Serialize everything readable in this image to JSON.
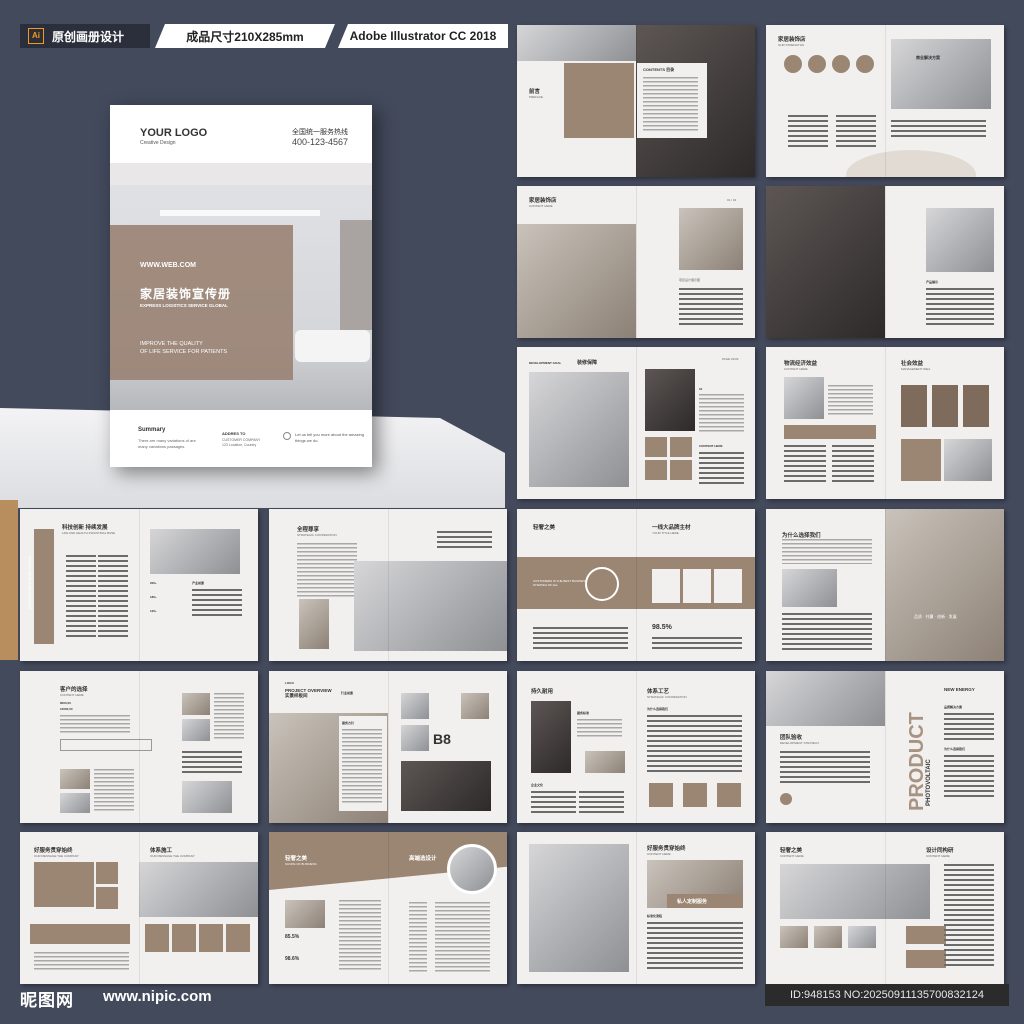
{
  "header": {
    "tag1_label": "原创画册设计",
    "tag1_icon": "Ai",
    "tag2_label": "成品尺寸210X285mm",
    "tag3_label": "Adobe Illustrator CC 2018"
  },
  "cover": {
    "logo": "YOUR LOGO",
    "logo_sub": "Creative Design",
    "hotline_label": "全国统一服务热线",
    "phone": "400-123-4567",
    "web": "WWW.WEB.COM",
    "title": "家居装饰宣传册",
    "title_en": "EXPRESS LOGISTICS SERVICE GLOBAL",
    "slogan_1": "IMPROVE THE QUALITY",
    "slogan_2": "OF LIFE SERVICE FOR PATIENTS",
    "summary_title": "Summary",
    "summary_text": "There are many variations of are many variations passages.",
    "address_title": "ADDRES TO",
    "address_text": "CUSTOMER COMPANY 123 Location, Country",
    "tail_text": "Let us tell you more about the amazing things we do."
  },
  "spreads": {
    "r1a": {
      "h1": "前言",
      "h1_en": "PREFACE",
      "h2": "CONTENTS 目录"
    },
    "r1b": {
      "h1": "家居装饰店",
      "h1_en": "OUR STRENGTHS",
      "h2": "商业解决方案"
    },
    "r2a": {
      "h1": "家居装饰店",
      "h1_en": "CONTENT HERE",
      "page": "01 / 02",
      "caption": "项目设计展示图"
    },
    "r2b": {
      "h1": "产品展示"
    },
    "r3a": {
      "h1": "DEVELOPMENT GOAL",
      "h1b": "装修保障",
      "page": "PAGE 01/02",
      "h2": "01",
      "h3": "CONTENT HERE"
    },
    "r3b": {
      "h1": "物流经济效益",
      "h1_en": "CONTENT HERE",
      "h2": "社会效益",
      "h2_en": "MANAGEMENT IDEA"
    },
    "r4a": {
      "h1": "科技创新 持续发展",
      "h1_en": "LIFE AND HEALTH INDUSTRIAL BASE",
      "v1": "200+",
      "v2": "180+",
      "v3": "120+",
      "side": "BUSINESS BROCHURE DESIGN",
      "label": "产业前景"
    },
    "r4b": {
      "h1": "全程尊享",
      "h1_en": "STRATEGIC COOPERATION"
    },
    "r4c": {
      "h1": "轻奢之美",
      "h2": "一线大品牌主材",
      "h2_en": "YOUR TITLE HERE",
      "banner": "CUSTOMERS IS THE BEST BUSINESS STRATEG OF ALL",
      "pct": "98.5%"
    },
    "r4d": {
      "h1": "为什么选择我们",
      "tagline": "品质 · 共赢 · 创新 · 发展"
    },
    "r5a": {
      "h1": "客户的选择",
      "h1_en": "CONTENT HERE",
      "v1": "8000,00",
      "v2": "10000,00"
    },
    "r5b": {
      "h1": "PROJECT OVERVIEW 实景样板间",
      "h2": "行业前景",
      "h3": "服务方针",
      "logo": "LOGO",
      "big": "B8"
    },
    "r5c": {
      "h1": "持久耐用",
      "h2": "体系工艺",
      "h2_en": "STRATEGIC COOPERATION",
      "h3": "为什么选择我们",
      "h4": "服务标准",
      "h5": "企业文化"
    },
    "r5d": {
      "h1": "PRODUCT",
      "h2": "PHOTOVOLTAIC",
      "h3": "NEW ENERGY",
      "h4": "团队验收",
      "h4_en": "DEVELOPMENT STRATEGY",
      "h5": "为什么选择我们",
      "h6": "品质解决方案"
    },
    "r6a": {
      "h1": "好服务贯穿始终",
      "h1_en": "OUR MESSAGE THE COMPANY",
      "h2": "体系施工",
      "h2_en": "OUR MESSAGE THE COMPANY"
    },
    "r6b": {
      "h1": "轻奢之美",
      "h1_en": "SCOPE OF BUSINESS",
      "h2": "高端选设计",
      "p1": "85.5%",
      "p2": "98.6%"
    },
    "r6c": {
      "h1": "好服务贯穿始终",
      "h1_en": "CONTENT HERE",
      "banner": "私人定制服务",
      "h2": "标准化流程"
    },
    "r6d": {
      "h1": "轻奢之美",
      "h1_en": "CONTENT HERE",
      "h2": "设计同构研",
      "h2_en": "CONTENT HERE"
    }
  },
  "footer": {
    "site_cn": "昵图网",
    "site_url": "www.nipic.com",
    "id_text": "ID:948153 NO:20250911135700832124"
  },
  "colors": {
    "background": "#434a5c",
    "accent_brown": "#9b8573",
    "paper": "#f2f0ee"
  }
}
